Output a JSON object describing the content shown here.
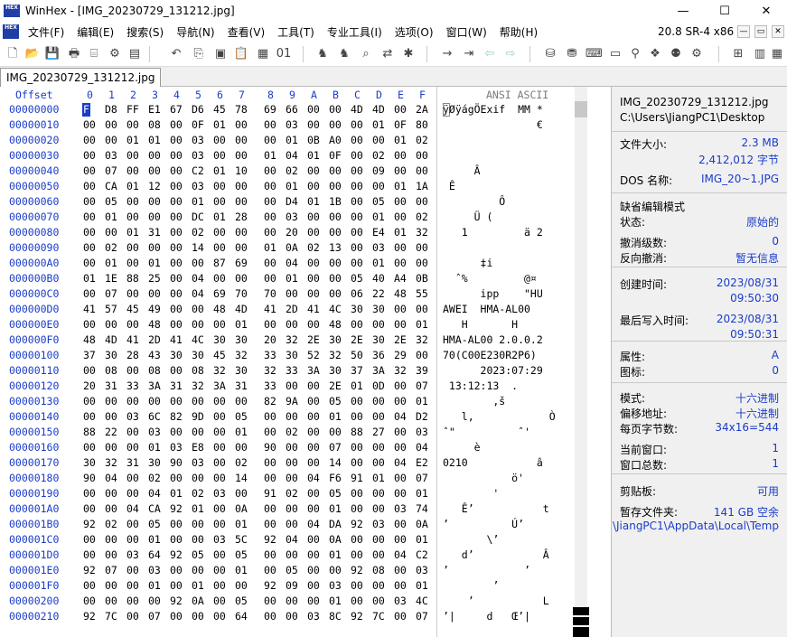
{
  "window": {
    "title": "WinHex - [IMG_20230729_131212.jpg]",
    "logo_text": "HEX",
    "minimize": "—",
    "maximize": "☐",
    "close": "✕",
    "version": "20.8 SR-4 x86"
  },
  "menu": [
    "文件(F)",
    "编辑(E)",
    "搜索(S)",
    "导航(N)",
    "查看(V)",
    "工具(T)",
    "专业工具(I)",
    "选项(O)",
    "窗口(W)",
    "帮助(H)"
  ],
  "toolbar_icons": [
    "new-file-icon",
    "open-file-icon",
    "save-icon",
    "print-icon",
    "properties-icon",
    "open-disk-icon",
    "undo-icon",
    "copy-icon",
    "paste-icon",
    "clipboard-icon",
    "write-icon",
    "binary-icon",
    "find-icon",
    "find-replace-icon",
    "find-hex-icon",
    "replace-hex-icon",
    "hex-search-icon",
    "goto-offset-icon",
    "goto-block-icon",
    "back-icon",
    "forward-icon",
    "disk-icon",
    "disk-editor-icon",
    "ram-icon",
    "calculator-icon",
    "analyze-icon",
    "hash-icon",
    "gear-icon",
    "windows-icon",
    "table-icon",
    "help-icon"
  ],
  "tab": {
    "label": "IMG_20230729_131212.jpg"
  },
  "hex": {
    "header_offset": "Offset",
    "columns": [
      "0",
      "1",
      "2",
      "3",
      "4",
      "5",
      "6",
      "7",
      "8",
      "9",
      "A",
      "B",
      "C",
      "D",
      "E",
      "F"
    ],
    "header_ansi": "ANSI ASCII",
    "rows": [
      {
        "offset": "00000000",
        "bytes": "FF D8 FF E1 67 D6 45 78  69 66 00 00 4D 4D 00 2A",
        "ascii": "ÿØÿágÖExif  MM *"
      },
      {
        "offset": "00000010",
        "bytes": "00 00 00 08 00 0F 01 00  00 03 00 00 00 01 0F 80",
        "ascii": "               €"
      },
      {
        "offset": "00000020",
        "bytes": "00 00 01 01 00 03 00 00  00 01 0B A0 00 00 01 02",
        "ascii": ""
      },
      {
        "offset": "00000030",
        "bytes": "00 03 00 00 00 03 00 00  01 04 01 0F 00 02 00 00",
        "ascii": ""
      },
      {
        "offset": "00000040",
        "bytes": "00 07 00 00 00 C2 01 10  00 02 00 00 00 09 00 00",
        "ascii": "     Â"
      },
      {
        "offset": "00000050",
        "bytes": "00 CA 01 12 00 03 00 00  00 01 00 00 00 00 01 1A",
        "ascii": " Ê"
      },
      {
        "offset": "00000060",
        "bytes": "00 05 00 00 00 01 00 00  00 D4 01 1B 00 05 00 00",
        "ascii": "         Ô"
      },
      {
        "offset": "00000070",
        "bytes": "00 01 00 00 00 DC 01 28  00 03 00 00 00 01 00 02",
        "ascii": "     Ü ("
      },
      {
        "offset": "00000080",
        "bytes": "00 00 01 31 00 02 00 00  00 20 00 00 00 E4 01 32",
        "ascii": "   1         ä 2"
      },
      {
        "offset": "00000090",
        "bytes": "00 02 00 00 00 14 00 00  01 0A 02 13 00 03 00 00",
        "ascii": ""
      },
      {
        "offset": "000000A0",
        "bytes": "00 01 00 01 00 00 87 69  00 04 00 00 00 01 00 00",
        "ascii": "      ‡i"
      },
      {
        "offset": "000000B0",
        "bytes": "01 1E 88 25 00 04 00 00  00 01 00 00 05 40 A4 0B",
        "ascii": "  ˆ%         @¤"
      },
      {
        "offset": "000000C0",
        "bytes": "00 07 00 00 00 04 69 70  70 00 00 00 06 22 48 55",
        "ascii": "      ipp    \"HU"
      },
      {
        "offset": "000000D0",
        "bytes": "41 57 45 49 00 00 48 4D  41 2D 41 4C 30 30 00 00",
        "ascii": "AWEI  HMA-AL00"
      },
      {
        "offset": "000000E0",
        "bytes": "00 00 00 48 00 00 00 01  00 00 00 48 00 00 00 01",
        "ascii": "   H       H"
      },
      {
        "offset": "000000F0",
        "bytes": "48 4D 41 2D 41 4C 30 30  20 32 2E 30 2E 30 2E 32",
        "ascii": "HMA-AL00 2.0.0.2"
      },
      {
        "offset": "00000100",
        "bytes": "37 30 28 43 30 30 45 32  33 30 52 32 50 36 29 00",
        "ascii": "70(C00E230R2P6)"
      },
      {
        "offset": "00000110",
        "bytes": "00 08 00 08 00 08 32 30  32 33 3A 30 37 3A 32 39",
        "ascii": "      2023:07:29"
      },
      {
        "offset": "00000120",
        "bytes": "20 31 33 3A 31 32 3A 31  33 00 00 2E 01 0D 00 07",
        "ascii": " 13:12:13  ."
      },
      {
        "offset": "00000130",
        "bytes": "00 00 00 00 00 00 00 00  82 9A 00 05 00 00 00 01",
        "ascii": "        ‚š"
      },
      {
        "offset": "00000140",
        "bytes": "00 00 03 6C 82 9D 00 05  00 00 00 01 00 00 04 D2",
        "ascii": "   l‚            Ò"
      },
      {
        "offset": "00000150",
        "bytes": "88 22 00 03 00 00 00 01  00 02 00 00 88 27 00 03",
        "ascii": "ˆ\"          ˆ'"
      },
      {
        "offset": "00000160",
        "bytes": "00 00 00 01 03 E8 00 00  90 00 00 07 00 00 00 04",
        "ascii": "     è"
      },
      {
        "offset": "00000170",
        "bytes": "30 32 31 30 90 03 00 02  00 00 00 14 00 00 04 E2",
        "ascii": "0210           â"
      },
      {
        "offset": "00000180",
        "bytes": "90 04 00 02 00 00 00 14  00 00 04 F6 91 01 00 07",
        "ascii": "           ö'"
      },
      {
        "offset": "00000190",
        "bytes": "00 00 00 04 01 02 03 00  91 02 00 05 00 00 00 01",
        "ascii": "        '"
      },
      {
        "offset": "000001A0",
        "bytes": "00 00 04 CA 92 01 00 0A  00 00 00 01 00 00 03 74",
        "ascii": "   Ê’           t"
      },
      {
        "offset": "000001B0",
        "bytes": "92 02 00 05 00 00 00 01  00 00 04 DA 92 03 00 0A",
        "ascii": "’          Ú’"
      },
      {
        "offset": "000001C0",
        "bytes": "00 00 00 01 00 00 03 5C  92 04 00 0A 00 00 00 01",
        "ascii": "       \\’"
      },
      {
        "offset": "000001D0",
        "bytes": "00 00 03 64 92 05 00 05  00 00 00 01 00 00 04 C2",
        "ascii": "   d’           Â"
      },
      {
        "offset": "000001E0",
        "bytes": "92 07 00 03 00 00 00 01  00 05 00 00 92 08 00 03",
        "ascii": "’            ’"
      },
      {
        "offset": "000001F0",
        "bytes": "00 00 00 01 00 01 00 00  92 09 00 03 00 00 00 01",
        "ascii": "        ’"
      },
      {
        "offset": "00000200",
        "bytes": "00 00 00 00 92 0A 00 05  00 00 00 01 00 00 03 4C",
        "ascii": "    ’           L"
      },
      {
        "offset": "00000210",
        "bytes": "92 7C 00 07 00 00 00 64  00 00 03 8C 92 7C 00 07",
        "ascii": "’|     d   Œ’|"
      }
    ]
  },
  "info": {
    "filename": "IMG_20230729_131212.jpg",
    "path": "C:\\Users\\JiangPC1\\Desktop",
    "file_size_label": "文件大小:",
    "file_size_mb": "2.3 MB",
    "file_size_bytes": "2,412,012 字节",
    "dos_name_label": "DOS 名称:",
    "dos_name": "IMG_20~1.JPG",
    "edit_mode": "缺省编辑模式",
    "state_label": "状态:",
    "state_value": "原始的",
    "undo_level_label": "撤消级数:",
    "undo_level_value": "0",
    "reverse_undo_label": "反向撤消:",
    "reverse_undo_value": "暂无信息",
    "created_label": "创建时间:",
    "created_date": "2023/08/31",
    "created_time": "09:50:30",
    "written_label": "最后写入时间:",
    "written_date": "2023/08/31",
    "written_time": "09:50:31",
    "attr_label": "属性:",
    "attr_value": "A",
    "icon_label": "图标:",
    "icon_value": "0",
    "mode_label": "模式:",
    "mode_value": "十六进制",
    "offset_addr_label": "偏移地址:",
    "offset_addr_value": "十六进制",
    "bytes_per_page_label": "每页字节数:",
    "bytes_per_page_value": "34x16=544",
    "current_window_label": "当前窗口:",
    "current_window_value": "1",
    "window_total_label": "窗口总数:",
    "window_total_value": "1",
    "clipboard_label": "剪贴板:",
    "clipboard_value": "可用",
    "temp_folder_label": "暂存文件夹:",
    "temp_free": "141 GB 空余",
    "temp_path": "\\JiangPC1\\AppData\\Local\\Temp"
  }
}
